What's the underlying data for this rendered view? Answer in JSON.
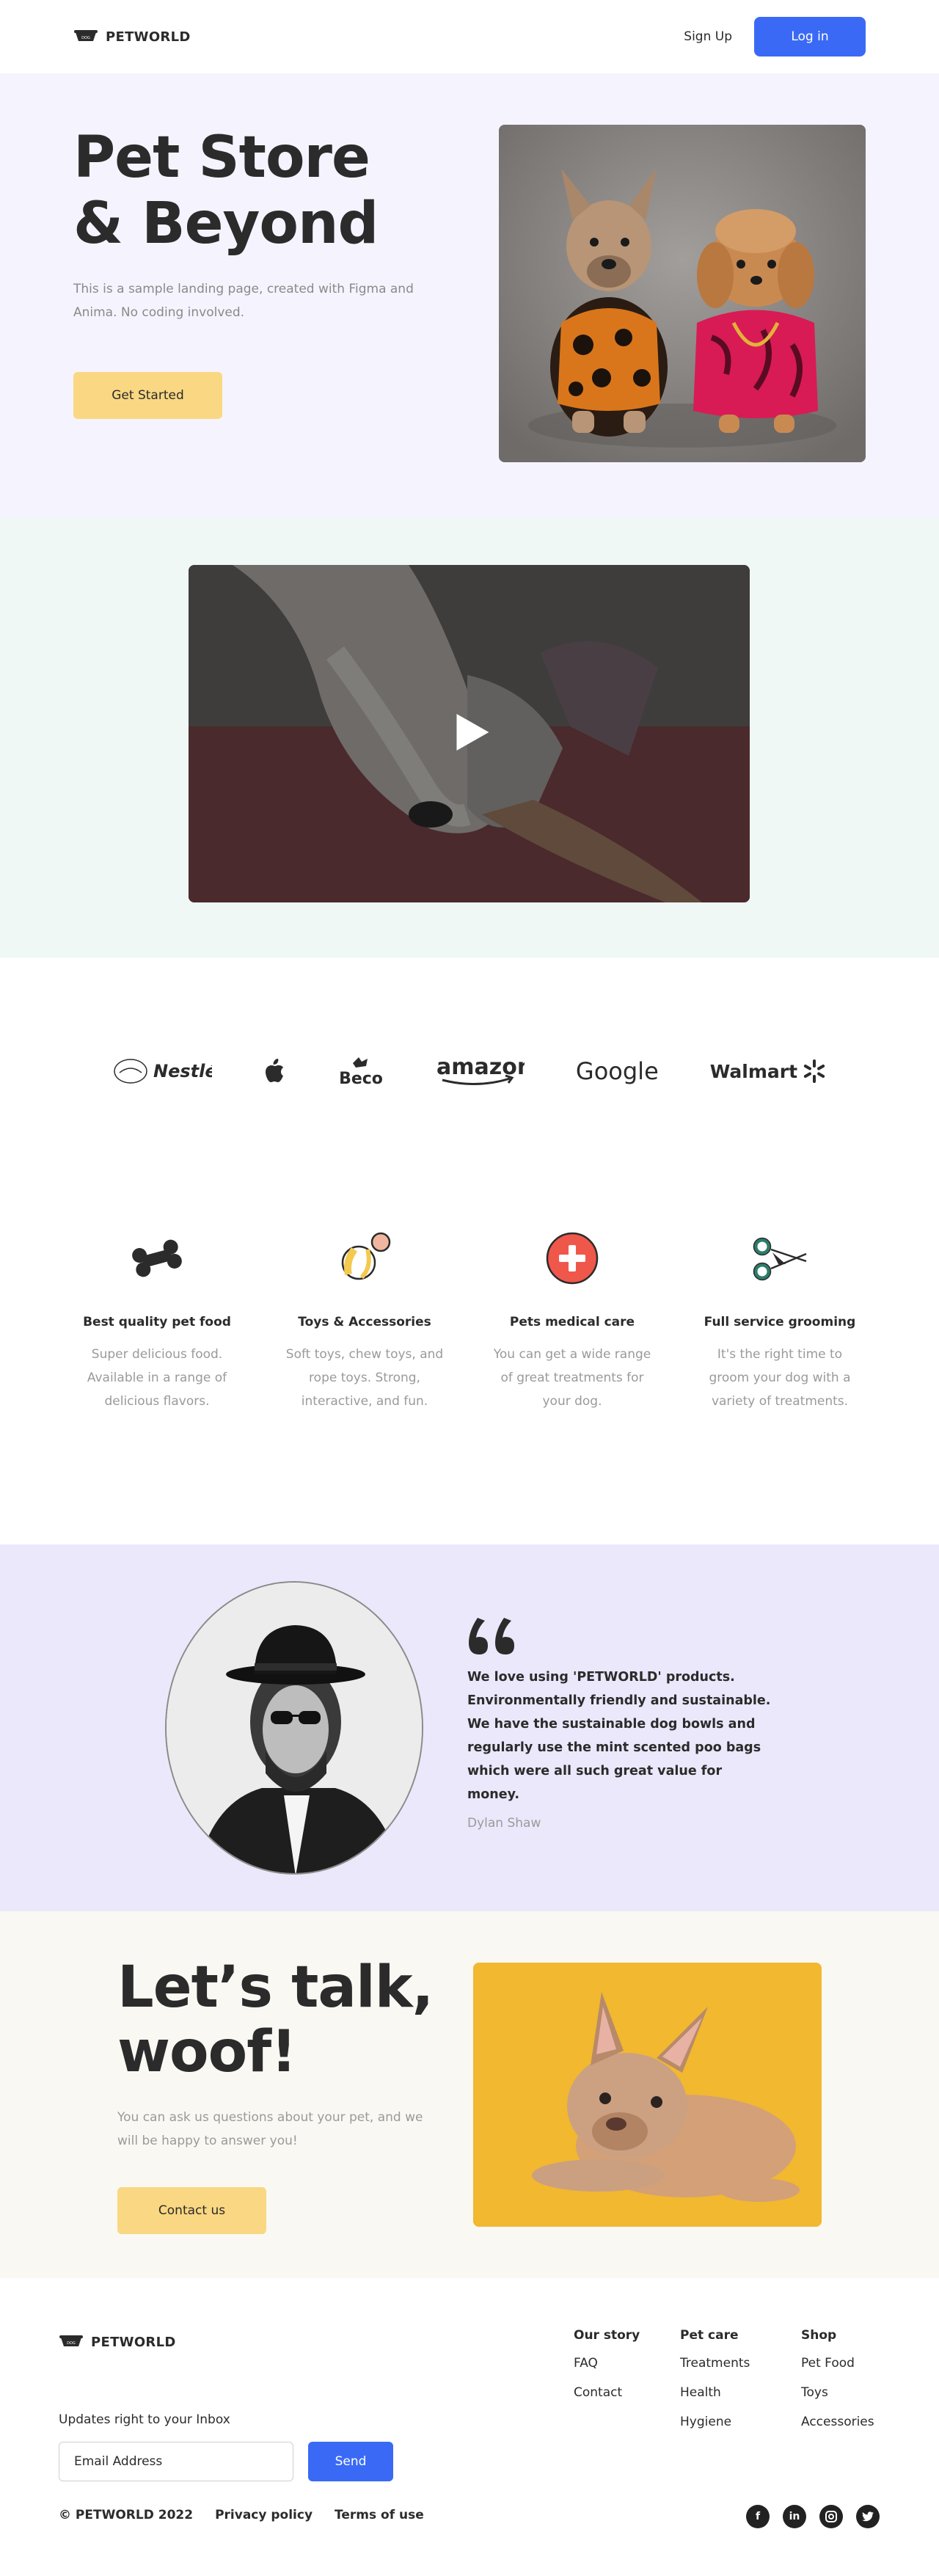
{
  "nav": {
    "brand": "PETWORLD",
    "signup": "Sign Up",
    "login": "Log in"
  },
  "hero": {
    "title_line1": "Pet Store",
    "title_line2": "& Beyond",
    "subtitle": "This is a sample landing page, created with Figma and Anima. No coding involved.",
    "cta": "Get Started"
  },
  "logos": [
    "Nestlé",
    "Beco",
    "amazon",
    "Google",
    "Walmart"
  ],
  "features": [
    {
      "title": "Best quality pet food",
      "desc": "Super delicious food. Available in a range of delicious flavors.",
      "icon": "bone-icon"
    },
    {
      "title": "Toys & Accessories",
      "desc": "Soft toys, chew toys, and rope toys. Strong, interactive, and fun.",
      "icon": "ball-toy-icon"
    },
    {
      "title": "Pets medical care",
      "desc": "You can get a wide range of great treatments for your dog.",
      "icon": "medical-cross-icon"
    },
    {
      "title": "Full service grooming",
      "desc": "It's the right time to groom your dog with a variety of treatments.",
      "icon": "scissors-icon"
    }
  ],
  "testimonial": {
    "quote": "We love using 'PETWORLD' products. Environmentally friendly and sustainable. We have the sustainable dog bowls and regularly use the mint scented poo bags which were all such great value for money.",
    "author": "Dylan Shaw"
  },
  "contact": {
    "title_line1": "Let’s talk,",
    "title_line2": "woof!",
    "subtitle": "You can ask us questions about your pet, and we will be happy to answer you!",
    "cta": "Contact us"
  },
  "footer": {
    "brand": "PETWORLD",
    "newsletter_label": "Updates right to your Inbox",
    "email_placeholder": "Email Address",
    "send": "Send",
    "copyright": "© PETWORLD 2022",
    "privacy": "Privacy policy",
    "terms": "Terms of use",
    "columns": [
      {
        "title": "Our story",
        "links": [
          "FAQ",
          "Contact"
        ]
      },
      {
        "title": "Pet care",
        "links": [
          "Treatments",
          "Health",
          "Hygiene"
        ]
      },
      {
        "title": "Shop",
        "links": [
          "Pet Food",
          "Toys",
          "Accessories"
        ]
      }
    ],
    "socials": [
      "facebook-icon",
      "linkedin-icon",
      "instagram-icon",
      "twitter-icon"
    ]
  },
  "colors": {
    "accent_blue": "#3a6af5",
    "accent_yellow": "#fad782",
    "hero_bg": "#f5f3fd",
    "video_bg": "#eff8f4",
    "testimonial_bg": "#ebe8fb",
    "contact_bg": "#f9f8f3"
  }
}
